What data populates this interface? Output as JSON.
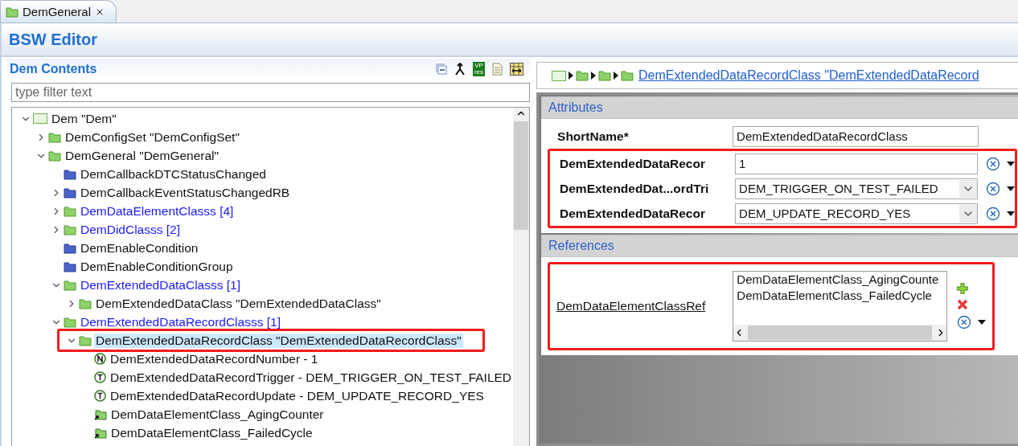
{
  "tab": {
    "title": "DemGeneral",
    "selected": true
  },
  "editor": {
    "title": "BSW Editor"
  },
  "contents": {
    "title": "Dem Contents",
    "toolbar": [
      {
        "kind": "collapse"
      },
      {
        "kind": "fork"
      },
      {
        "kind": "badge",
        "lines": [
          "VP",
          "res"
        ]
      },
      {
        "kind": "document"
      },
      {
        "kind": "table"
      }
    ],
    "filter": {
      "placeholder": "type filter text"
    },
    "tree": [
      {
        "label": "Dem \"Dem\"",
        "kind": "module",
        "expanded": true,
        "selected": false,
        "children": [
          {
            "label": "DemConfigSet \"DemConfigSet\"",
            "kind": "container",
            "expanded": false,
            "selected": false
          },
          {
            "label": "DemGeneral \"DemGeneral\"",
            "kind": "container",
            "expanded": true,
            "selected": false,
            "children": [
              {
                "label": "DemCallbackDTCStatusChanged",
                "kind": "definition",
                "selected": false
              },
              {
                "label": "DemCallbackEventStatusChangedRB",
                "kind": "definition",
                "expanded": false,
                "selected": false
              },
              {
                "label": "DemDataElementClasss [4]",
                "kind": "list",
                "expanded": false,
                "selected": false
              },
              {
                "label": "DemDidClasss [2]",
                "kind": "list",
                "expanded": false,
                "selected": false
              },
              {
                "label": "DemEnableCondition",
                "kind": "definition",
                "selected": false
              },
              {
                "label": "DemEnableConditionGroup",
                "kind": "definition",
                "selected": false
              },
              {
                "label": "DemExtendedDataClasss [1]",
                "kind": "list",
                "expanded": true,
                "selected": false,
                "children": [
                  {
                    "label": "DemExtendedDataClass \"DemExtendedDataClass\"",
                    "kind": "container",
                    "expanded": false,
                    "selected": false
                  }
                ]
              },
              {
                "label": "DemExtendedDataRecordClasss [1]",
                "kind": "list",
                "expanded": true,
                "selected": false,
                "children": [
                  {
                    "label": "DemExtendedDataRecordClass \"DemExtendedDataRecordClass\"",
                    "kind": "container",
                    "expanded": true,
                    "selected": true,
                    "highlighted": true,
                    "children": [
                      {
                        "label": "DemExtendedDataRecordNumber - 1",
                        "kind": "number",
                        "selected": false
                      },
                      {
                        "label": "DemExtendedDataRecordTrigger - DEM_TRIGGER_ON_TEST_FAILED",
                        "kind": "enum",
                        "selected": false
                      },
                      {
                        "label": "DemExtendedDataRecordUpdate - DEM_UPDATE_RECORD_YES",
                        "kind": "enum",
                        "selected": false
                      },
                      {
                        "label": "DemDataElementClass_AgingCounter",
                        "kind": "reference",
                        "selected": false
                      },
                      {
                        "label": "DemDataElementClass_FailedCycle",
                        "kind": "reference",
                        "selected": false
                      }
                    ]
                  }
                ]
              }
            ]
          }
        ]
      }
    ]
  },
  "breadcrumb": {
    "link": "DemExtendedDataRecordClass \"DemExtendedDataRecord"
  },
  "attributes": {
    "title": "Attributes",
    "fields": [
      {
        "label": "ShortName*",
        "value": "DemExtendedDataRecordClass",
        "kind": "text",
        "highlighted": false
      },
      {
        "label": "DemExtendedDataRecor",
        "value": "1",
        "kind": "number",
        "highlighted": true
      },
      {
        "label": "DemExtendedDat...ordTri",
        "value": "DEM_TRIGGER_ON_TEST_FAILED",
        "kind": "combo",
        "highlighted": true
      },
      {
        "label": "DemExtendedDataRecor",
        "value": "DEM_UPDATE_RECORD_YES",
        "kind": "combo",
        "highlighted": true
      }
    ]
  },
  "references": {
    "title": "References",
    "highlighted": true,
    "items": [
      {
        "label": "DemDataElementClassRef",
        "values": [
          "DemDataElementClass_AgingCounte",
          "DemDataElementClass_FailedCycle"
        ]
      }
    ]
  }
}
